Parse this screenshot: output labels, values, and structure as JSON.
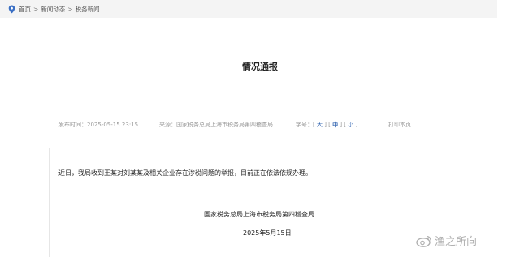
{
  "breadcrumb": {
    "icon": "location-pin-icon",
    "items": [
      "首页",
      "新闻动态",
      "税务新闻"
    ],
    "separator": ">"
  },
  "article": {
    "title": "情况通报",
    "published_label": "发布时间：",
    "published_value": "2025-05-15 23:15",
    "source_label": "来源：",
    "source_value": "国家税务总局上海市税务局第四稽查局",
    "font_size_label": "字号：",
    "font_size_options": [
      "大",
      "中",
      "小"
    ],
    "font_size_selected": "中",
    "print_label": "打印本页",
    "body": "近日，我局收到王某对刘某某及相关企业存在涉税问题的举报，目前正在依法依规办理。",
    "signature": "国家税务总局上海市税务局第四稽查局",
    "date": "2025年5月15日"
  },
  "watermark": {
    "text": "渔之所向",
    "icon": "weibo-logo-icon"
  },
  "colors": {
    "breadcrumb_bg": "#f4f4f4",
    "link_blue": "#3d6db5",
    "meta_gray": "#999999",
    "pin_blue": "#3a6fc4"
  }
}
